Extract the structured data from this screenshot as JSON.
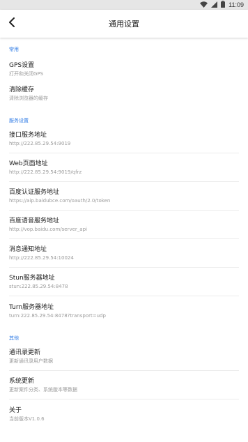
{
  "status_bar": {
    "time": "11:09"
  },
  "app_bar": {
    "title": "通用设置"
  },
  "sections": [
    {
      "header": "常用",
      "items": [
        {
          "title": "GPS设置",
          "subtitle": "打开和关闭GPS"
        },
        {
          "title": "清除缓存",
          "subtitle": "清除浏览器的缓存"
        }
      ]
    },
    {
      "header": "服务设置",
      "items": [
        {
          "title": "接口服务地址",
          "subtitle": "http://222.85.29.54:9019"
        },
        {
          "title": "Web页面地址",
          "subtitle": "http://222.85.29.54:9019/qfrz"
        },
        {
          "title": "百度认证服务地址",
          "subtitle": "https://aip.baidubce.com/oauth/2.0/token"
        },
        {
          "title": "百度语音服务地址",
          "subtitle": "http://vop.baidu.com/server_api"
        },
        {
          "title": "消息通知地址",
          "subtitle": "http://222.85.29.54:10024"
        },
        {
          "title": "Stun服务器地址",
          "subtitle": "stun:222.85.29.54:8478"
        },
        {
          "title": "Turn服务器地址",
          "subtitle": "turn:222.85.29.54:8478?transport=udp"
        }
      ]
    },
    {
      "header": "其他",
      "items": [
        {
          "title": "通讯录更新",
          "subtitle": "更新通讯录用户数据"
        },
        {
          "title": "系统更新",
          "subtitle": "更新案件分类、系统版本等数据"
        },
        {
          "title": "关于",
          "subtitle": "当前版本V1.0.6"
        }
      ]
    }
  ]
}
